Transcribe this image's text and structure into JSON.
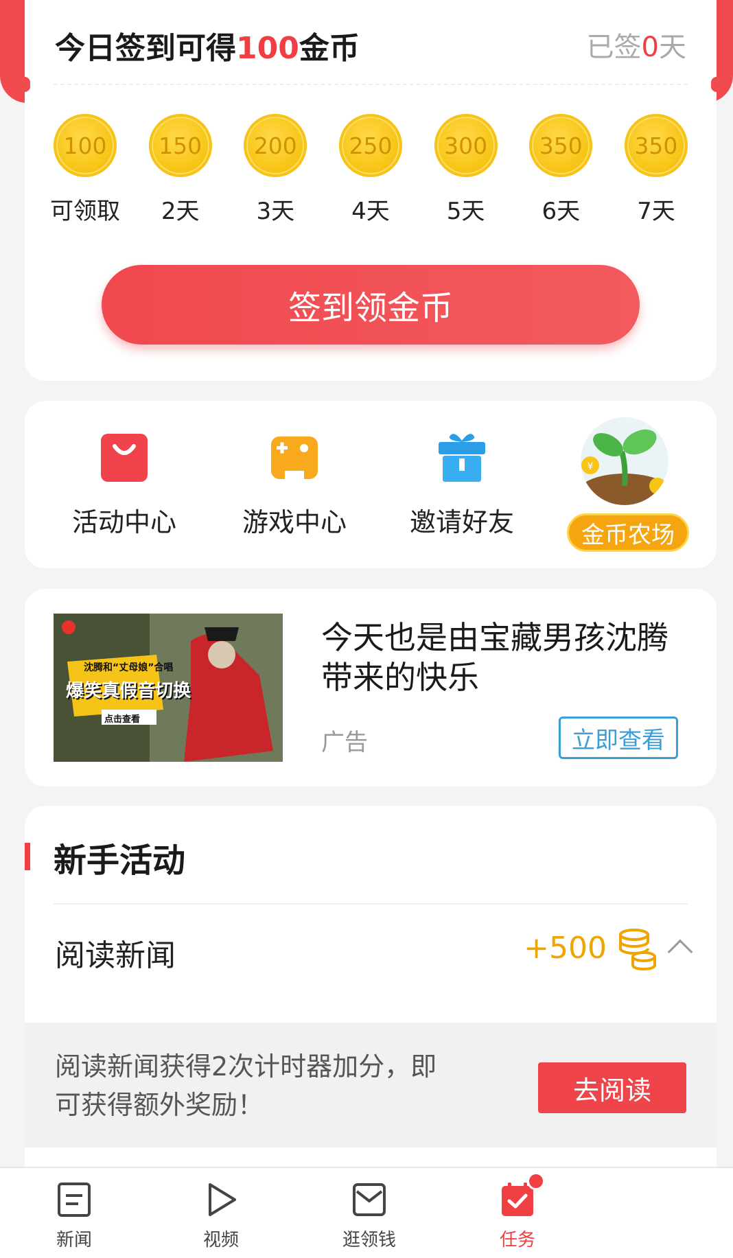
{
  "signin": {
    "title_prefix": "今日签到可得",
    "title_amount": "100",
    "title_suffix": "金币",
    "signed_prefix": "已签",
    "signed_days": "0",
    "signed_suffix": "天",
    "coins": [
      {
        "value": "100",
        "label": "可领取"
      },
      {
        "value": "150",
        "label": "2天"
      },
      {
        "value": "200",
        "label": "3天"
      },
      {
        "value": "250",
        "label": "4天"
      },
      {
        "value": "300",
        "label": "5天"
      },
      {
        "value": "350",
        "label": "6天"
      },
      {
        "value": "350",
        "label": "7天"
      }
    ],
    "button_label": "签到领金币"
  },
  "quick_entries": {
    "activity_center": "活动中心",
    "game_center": "游戏中心",
    "invite_friends": "邀请好友",
    "coin_farm": "金币农场"
  },
  "ad": {
    "title": "今天也是由宝藏男孩沈腾带来的快乐",
    "tag": "广告",
    "button_label": "立即查看",
    "thumb_texts": {
      "top": "沈腾和“丈母娘”合唱",
      "headline": "爆笑真假音切换",
      "cta": "点击查看"
    }
  },
  "newbie": {
    "section_title": "新手活动",
    "task_name": "阅读新闻",
    "task_reward": "+500",
    "task_description": "阅读新闻获得2次计时器加分，即可获得额外奖励！",
    "task_button": "去阅读"
  },
  "bottom_nav": {
    "items": [
      {
        "label": "新闻"
      },
      {
        "label": "视频"
      },
      {
        "label": "逛领钱"
      },
      {
        "label": "任务"
      }
    ]
  },
  "colors": {
    "brand_red": "#ef3f43",
    "coin_gold": "#f8c516",
    "reward_orange": "#f0a400",
    "link_blue": "#3a9fd8"
  }
}
